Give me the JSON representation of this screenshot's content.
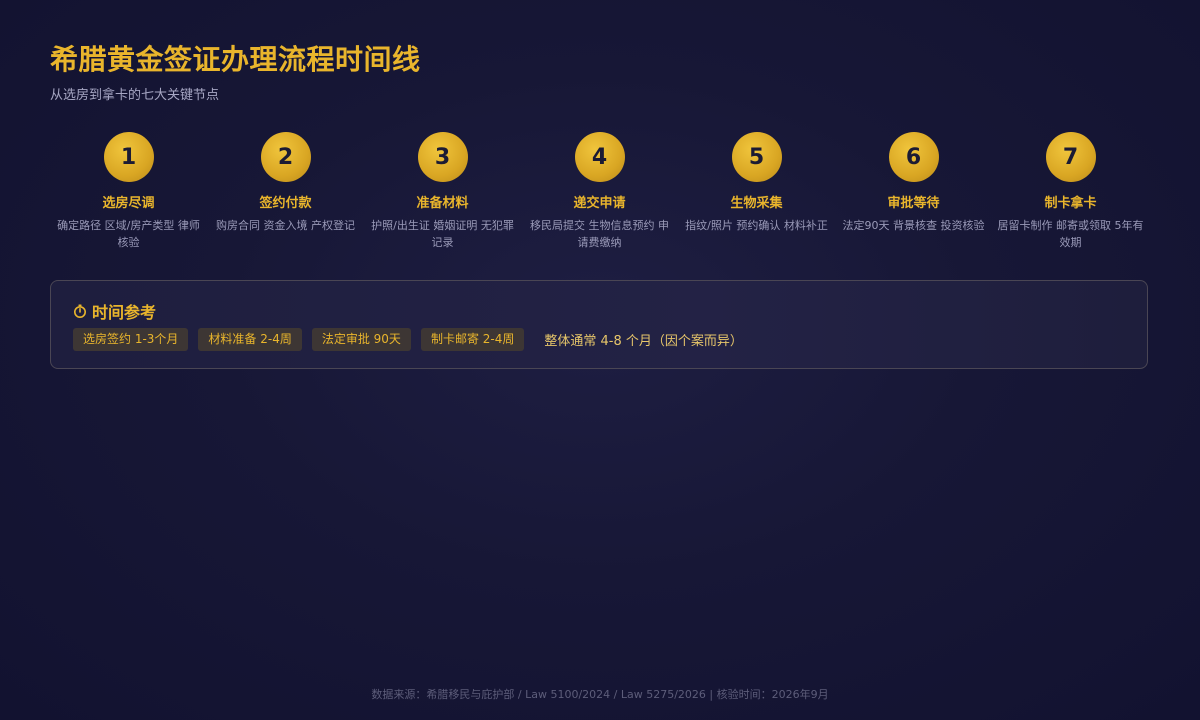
{
  "header": {
    "title": "希腊黄金签证办理流程时间线",
    "subtitle": "从选房到拿卡的七大关键节点"
  },
  "steps": [
    {
      "number": "1",
      "title": "选房尽调",
      "desc": "确定路径 区域/房产类型 律师核验"
    },
    {
      "number": "2",
      "title": "签约付款",
      "desc": "购房合同 资金入境 产权登记"
    },
    {
      "number": "3",
      "title": "准备材料",
      "desc": "护照/出生证 婚姻证明 无犯罪记录"
    },
    {
      "number": "4",
      "title": "递交申请",
      "desc": "移民局提交 生物信息预约 申请费缴纳"
    },
    {
      "number": "5",
      "title": "生物采集",
      "desc": "指纹/照片 预约确认 材料补正"
    },
    {
      "number": "6",
      "title": "审批等待",
      "desc": "法定90天 背景核查 投资核验"
    },
    {
      "number": "7",
      "title": "制卡拿卡",
      "desc": "居留卡制作 邮寄或领取 5年有效期"
    }
  ],
  "time_reference": {
    "icon": "stopwatch-icon",
    "title": "时间参考",
    "tags": [
      "选房签约 1-3个月",
      "材料准备 2-4周",
      "法定审批 90天",
      "制卡邮寄 2-4周"
    ],
    "total": "整体通常 4-8 个月（因个案而异）"
  },
  "footer": {
    "text": "数据来源：希腊移民与庇护部 / Law 5100/2024 / Law 5275/2026  |  核验时间：2026年9月"
  },
  "colors": {
    "accent_gold": "#e9b52c",
    "background": "#171736",
    "tag_bg": "#3d3634"
  }
}
